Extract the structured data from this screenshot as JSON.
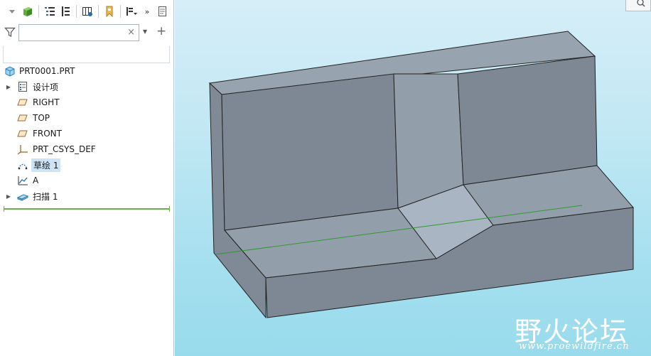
{
  "toolbar": {
    "buttons": [
      "dropdown-arrow-icon",
      "model-cube-icon",
      "tree-view-icon",
      "tree-filters-icon",
      "table-columns-icon",
      "bookmark-icon",
      "settings-dropdown-icon",
      "more-icon",
      "notes-icon"
    ],
    "more_label": "»"
  },
  "filter": {
    "search_value": "",
    "clear_symbol": "×",
    "dropdown_symbol": "▾",
    "add_symbol": "+"
  },
  "tree": {
    "root": "PRT0001.PRT",
    "items": [
      {
        "label": "设计项",
        "icon": "design-items-icon",
        "expandable": true
      },
      {
        "label": "RIGHT",
        "icon": "datum-plane-icon",
        "expandable": false
      },
      {
        "label": "TOP",
        "icon": "datum-plane-icon",
        "expandable": false
      },
      {
        "label": "FRONT",
        "icon": "datum-plane-icon",
        "expandable": false
      },
      {
        "label": "PRT_CSYS_DEF",
        "icon": "csys-icon",
        "expandable": false
      },
      {
        "label": "草绘 1",
        "icon": "sketch-icon",
        "expandable": false,
        "selected": true
      },
      {
        "label": "A",
        "icon": "datum-curve-icon",
        "expandable": false
      },
      {
        "label": "扫描 1",
        "icon": "sweep-icon",
        "expandable": true
      }
    ]
  },
  "viewport": {
    "background_top": "#d6eef8",
    "background_bottom": "#98dbec",
    "model_face_color": "#7d8894",
    "model_top_color": "#939eab",
    "model_highlight_color": "#a9b5c2",
    "trajectory_color": "#2e9b2e"
  },
  "watermark": {
    "chinese": "野火论坛",
    "url": "www.proewildfire.cn"
  }
}
